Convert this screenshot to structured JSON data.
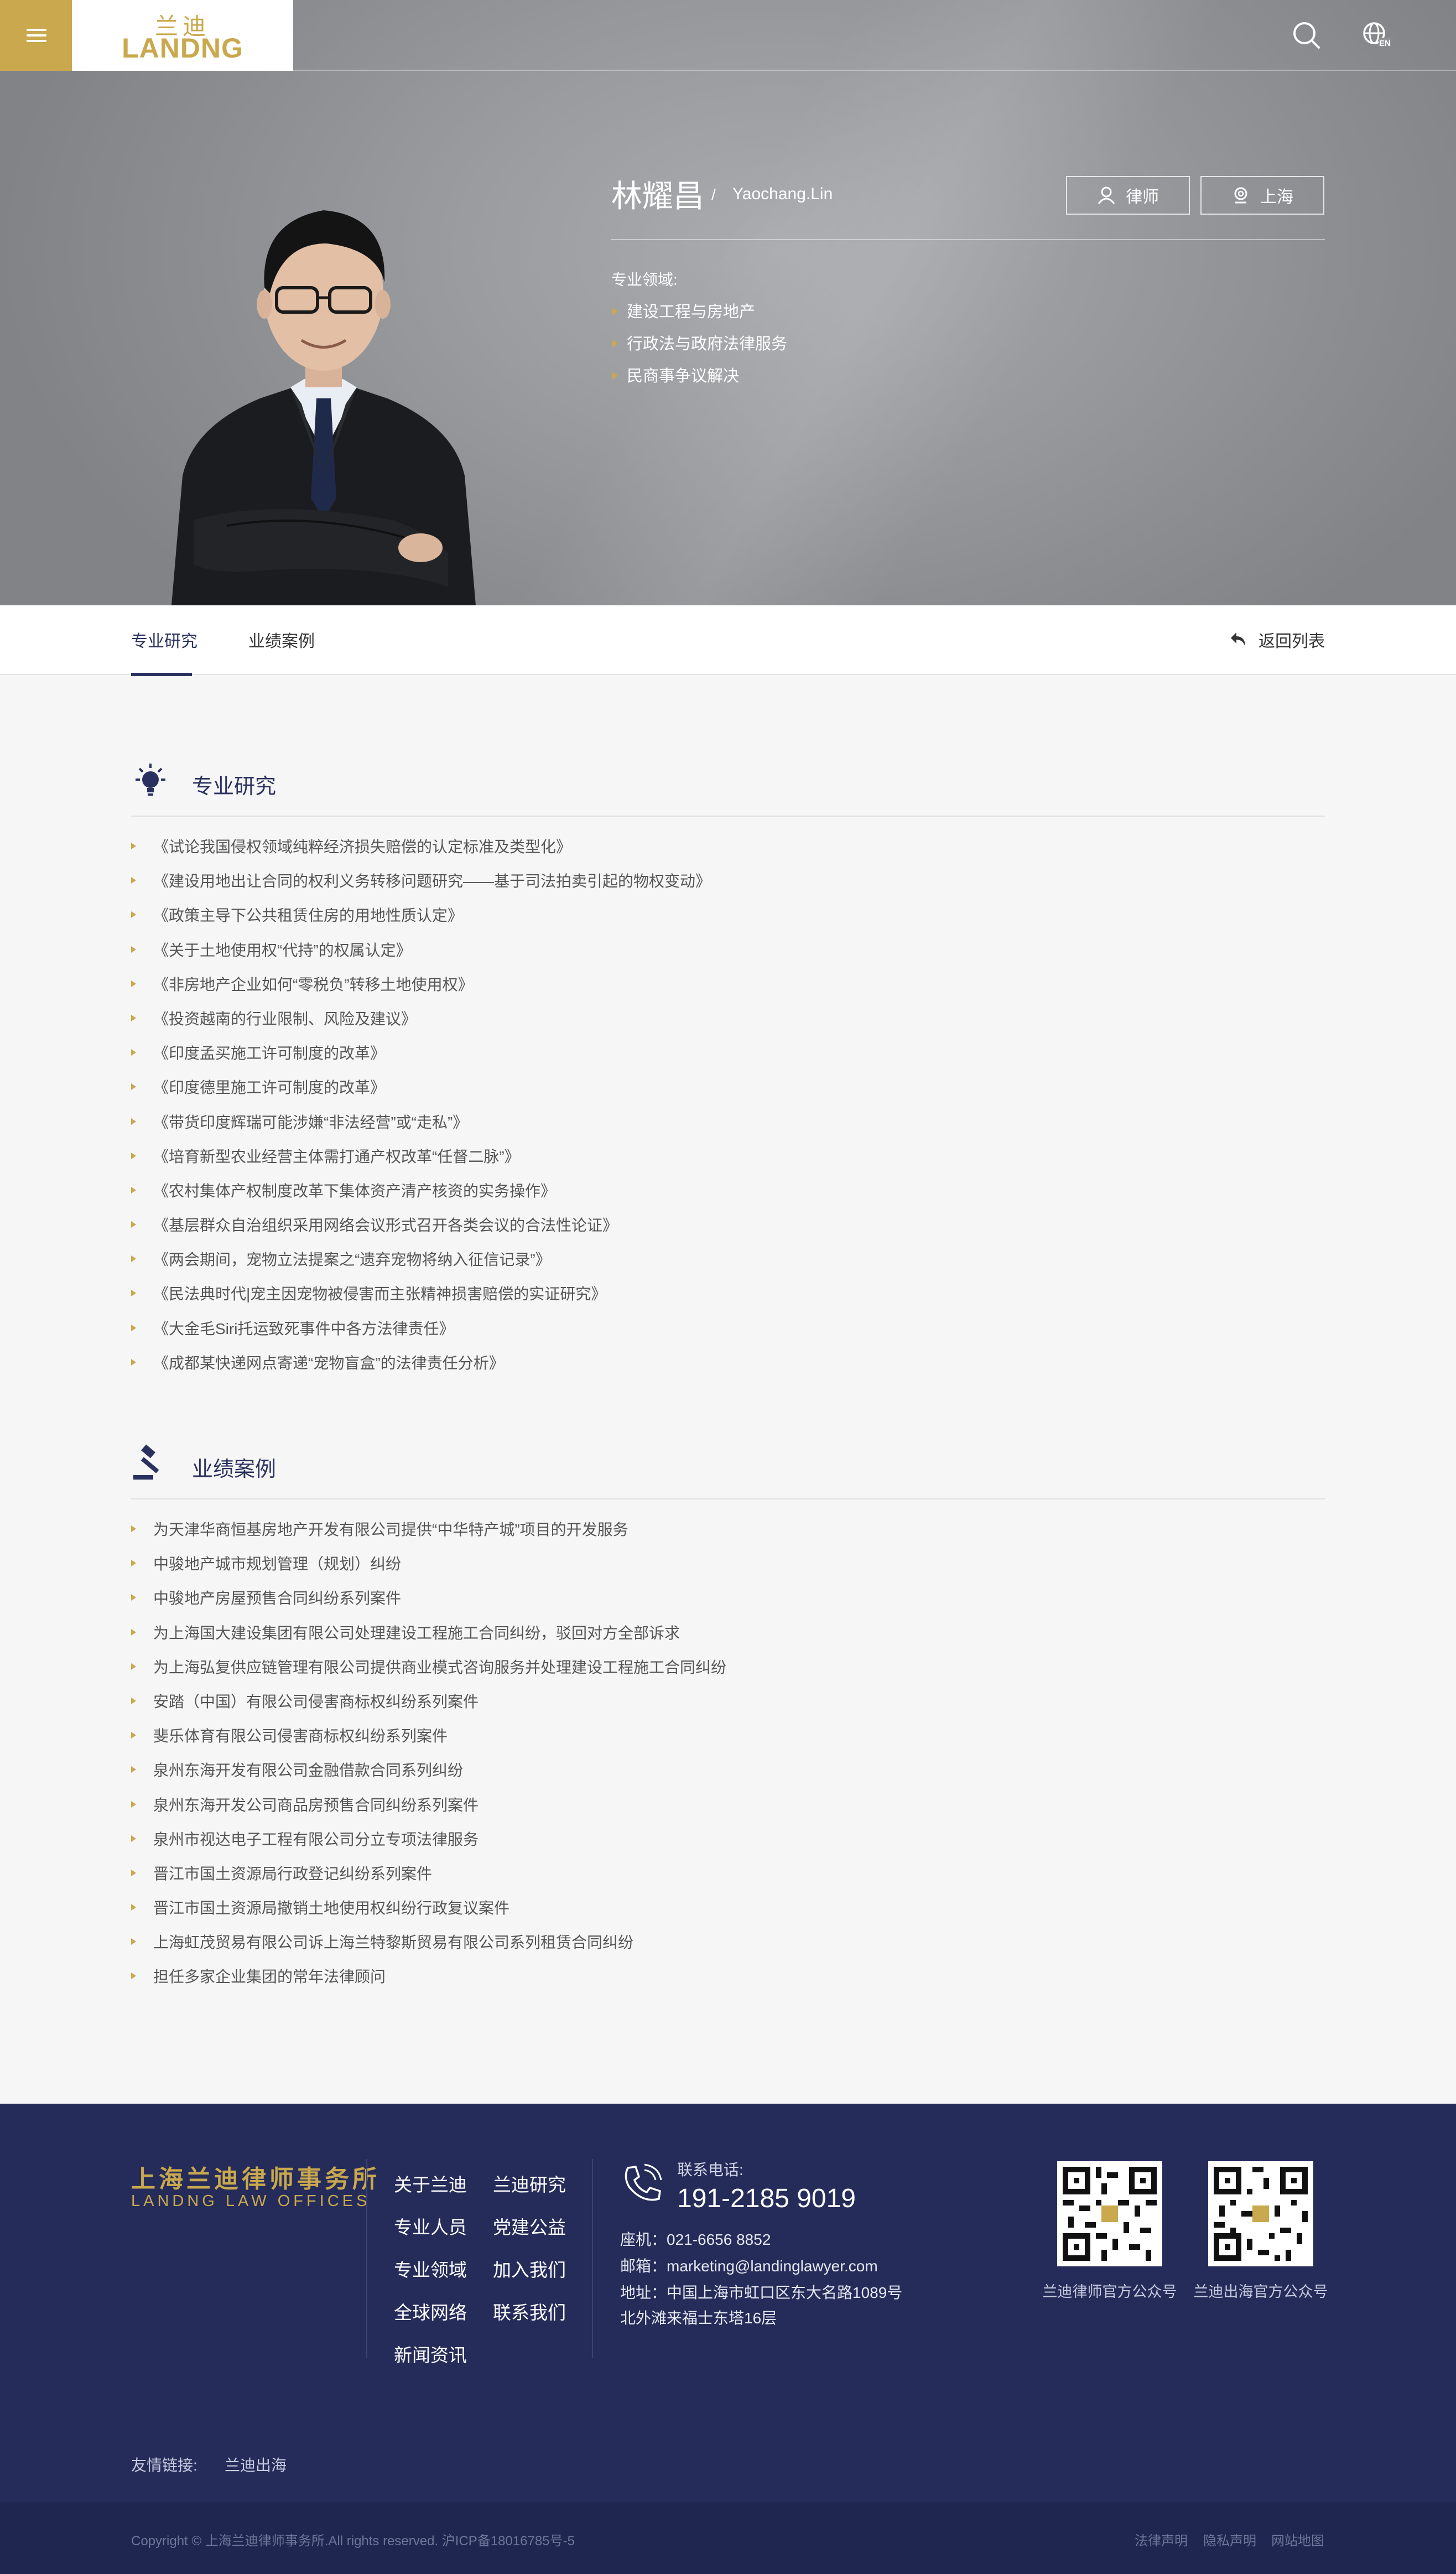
{
  "header": {
    "logo_cn": "兰迪",
    "logo_en": "LANDNG"
  },
  "profile": {
    "name": "林耀昌",
    "separator": "/",
    "name_en": "Yaochang.Lin",
    "role_tag": "律师",
    "city_tag": "上海",
    "areas_label": "专业领域:",
    "areas": [
      "建设工程与房地产",
      "行政法与政府法律服务",
      "民商事争议解决"
    ]
  },
  "tabs": {
    "research": "专业研究",
    "cases": "业绩案例",
    "back": "返回列表"
  },
  "research": {
    "title": "专业研究",
    "items": [
      "《试论我国侵权领域纯粹经济损失赔偿的认定标准及类型化》",
      "《建设用地出让合同的权利义务转移问题研究——基于司法拍卖引起的物权变动》",
      "《政策主导下公共租赁住房的用地性质认定》",
      "《关于土地使用权“代持”的权属认定》",
      "《非房地产企业如何“零税负”转移土地使用权》",
      "《投资越南的行业限制、风险及建议》",
      "《印度孟买施工许可制度的改革》",
      "《印度德里施工许可制度的改革》",
      "《带货印度辉瑞可能涉嫌“非法经营”或“走私”》",
      "《培育新型农业经营主体需打通产权改革“任督二脉”》",
      "《农村集体产权制度改革下集体资产清产核资的实务操作》",
      "《基层群众自治组织采用网络会议形式召开各类会议的合法性论证》",
      "《两会期间，宠物立法提案之“遗弃宠物将纳入征信记录”》",
      "《民法典时代|宠主因宠物被侵害而主张精神损害赔偿的实证研究》",
      "《大金毛Siri托运致死事件中各方法律责任》",
      "《成都某快递网点寄递“宠物盲盒”的法律责任分析》"
    ]
  },
  "cases": {
    "title": "业绩案例",
    "items": [
      "为天津华商恒基房地产开发有限公司提供“中华特产城”项目的开发服务",
      "中骏地产城市规划管理（规划）纠纷",
      "中骏地产房屋预售合同纠纷系列案件",
      "为上海国大建设集团有限公司处理建设工程施工合同纠纷，驳回对方全部诉求",
      "为上海弘复供应链管理有限公司提供商业模式咨询服务并处理建设工程施工合同纠纷",
      "安踏（中国）有限公司侵害商标权纠纷系列案件",
      "斐乐体育有限公司侵害商标权纠纷系列案件",
      "泉州东海开发有限公司金融借款合同系列纠纷",
      "泉州东海开发公司商品房预售合同纠纷系列案件",
      "泉州市视达电子工程有限公司分立专项法律服务",
      "晋江市国土资源局行政登记纠纷系列案件",
      "晋江市国土资源局撤销土地使用权纠纷行政复议案件",
      "上海虹茂贸易有限公司诉上海兰特黎斯贸易有限公司系列租赁合同纠纷",
      "担任多家企业集团的常年法律顾问"
    ]
  },
  "footer": {
    "logo_cn": "上海兰迪律师事务所",
    "logo_en": "LANDNG LAW OFFICES",
    "nav_col1": [
      "关于兰迪",
      "专业人员",
      "专业领域",
      "全球网络",
      "新闻资讯"
    ],
    "nav_col2": [
      "兰迪研究",
      "党建公益",
      "加入我们",
      "联系我们"
    ],
    "contact_label": "联系电话:",
    "phone": "191-2185 9019",
    "landline": "座机：021-6656 8852",
    "email": "邮箱：marketing@landinglawyer.com",
    "address1": "地址：中国上海市虹口区东大名路1089号",
    "address2": "北外滩来福士东塔16层",
    "qr1_label": "兰迪律师官方公众号",
    "qr2_label": "兰迪出海官方公众号",
    "friend_label": "友情链接:",
    "friend_link": "兰迪出海",
    "copyright": "Copyright © 上海兰迪律师事务所.All rights reserved. 沪ICP备18016785号-5",
    "bottom_links": [
      "法律声明",
      "隐私声明",
      "网站地图"
    ]
  },
  "colors": {
    "gold": "#c9a84e",
    "navy": "#252c5a",
    "navy_dark": "#1f2650",
    "tab_active": "#2a3160"
  }
}
